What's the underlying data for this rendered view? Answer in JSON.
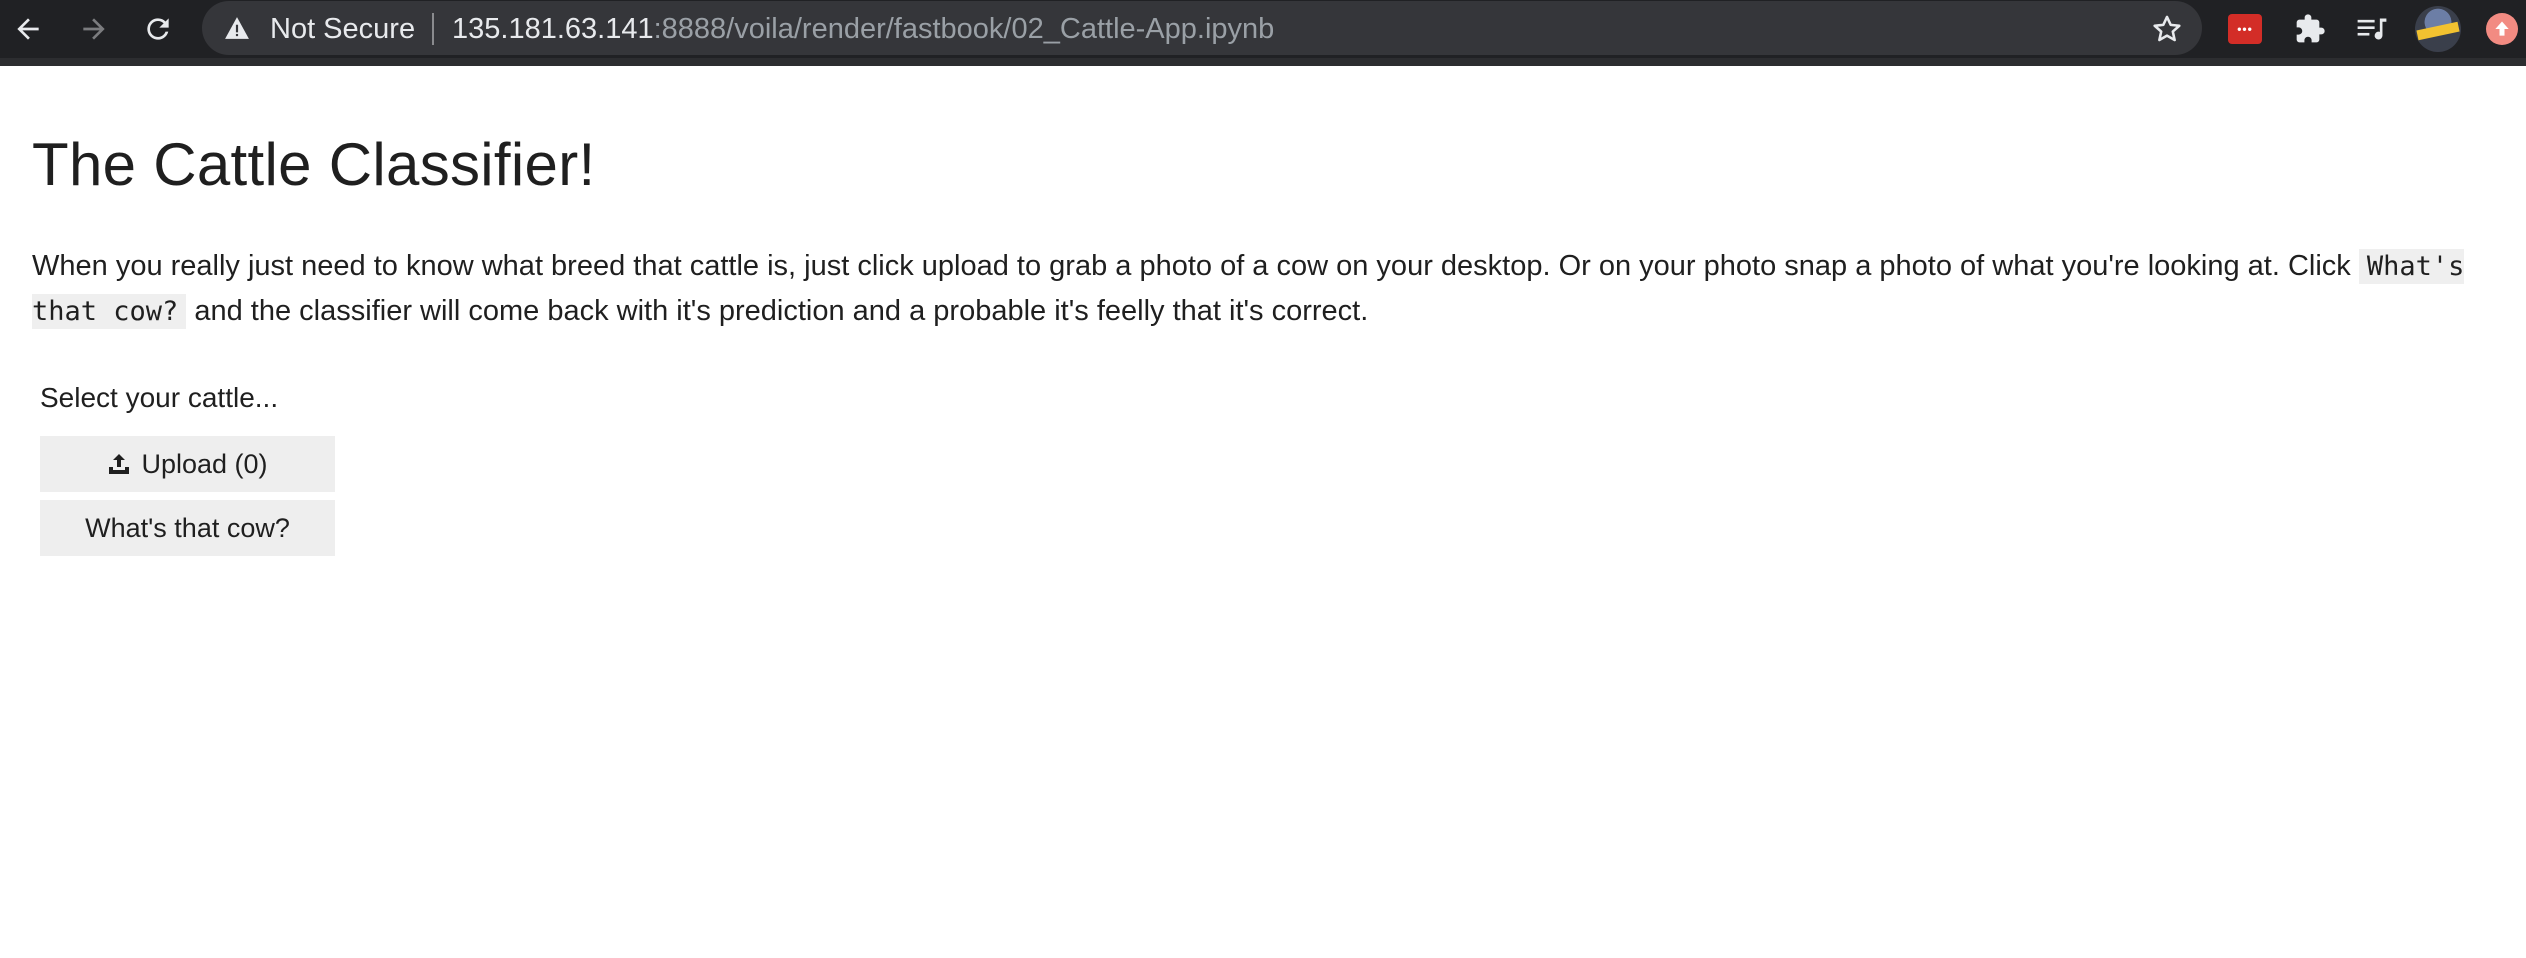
{
  "browser": {
    "security_label": "Not Secure",
    "url_host": "135.181.63.141",
    "url_path": ":8888/voila/render/fastbook/02_Cattle-App.ipynb",
    "icons": {
      "back": "arrow-left-icon",
      "forward": "arrow-right-icon",
      "reload": "reload-icon",
      "security": "warning-triangle-icon",
      "bookmark": "star-icon",
      "extensions": [
        "lastpass-icon",
        "puzzle-icon",
        "media-queue-icon"
      ],
      "profile": "avatar",
      "update": "update-arrow-icon"
    },
    "lastpass_label": "•••",
    "colors": {
      "toolbar": "#202124",
      "omnibox": "#35363a",
      "lastpass": "#d32d27",
      "update": "#f28b82"
    }
  },
  "page": {
    "title": "The Cattle Classifier!",
    "description_part1": "When you really just need to know what breed that cattle is, just click upload to grab a photo of a cow on your desktop. Or on your photo snap a photo of what you're looking at. Click ",
    "description_code": "What's that cow?",
    "description_part2": " and the classifier will come back with it's prediction and a probable it's feelly that it's correct.",
    "select_label": "Select your cattle...",
    "upload_label": "Upload (0)",
    "predict_label": "What's that cow?"
  }
}
